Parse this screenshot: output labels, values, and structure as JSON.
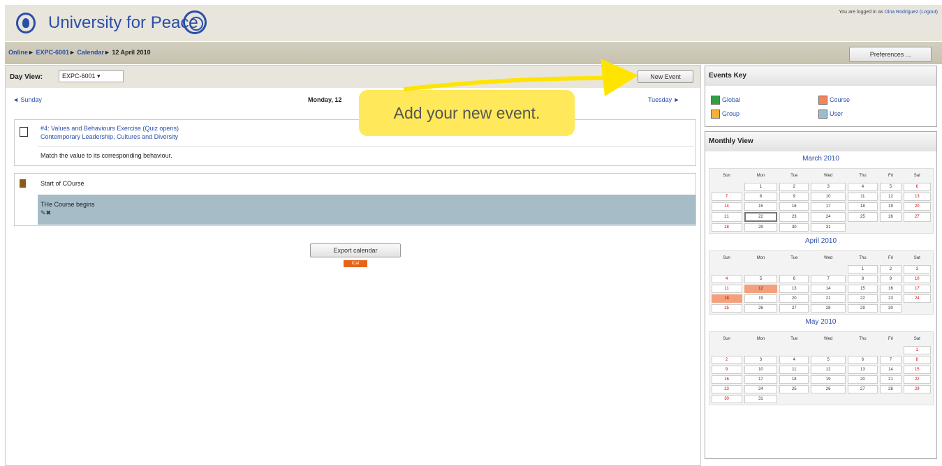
{
  "header": {
    "site_name": "University for Peace",
    "login_prefix": "You are logged in as",
    "user_name": "Dina Rodriguez",
    "logout_label": "(Logout)"
  },
  "breadcrumb": {
    "items": [
      "Online",
      "EXPC-6001",
      "Calendar"
    ],
    "current": "12 April 2010",
    "separator": "►"
  },
  "preferences_label": "Preferences ...",
  "day_view": {
    "label": "Day View:",
    "course_select": "EXPC-6001",
    "new_event_label": "New Event",
    "prev_label": "◄ Sunday",
    "date_heading": "Monday, 12",
    "next_label": "Tuesday ►"
  },
  "events": [
    {
      "title": "#4: Values and Behaviours Exercise (Quiz opens)",
      "course": "Contemporary Leadership, Cultures and Diversity",
      "description": "Match the value to its corresponding behaviour."
    },
    {
      "title": "Start of COurse",
      "description": "THe Course begins",
      "actions": "✎✖"
    }
  ],
  "export_label": "Export calendar",
  "ical_label": "iCal",
  "callout": "Add your new event.",
  "events_key": {
    "title": "Events Key",
    "items": [
      {
        "label": "Global",
        "color": "#2fa040"
      },
      {
        "label": "Course",
        "color": "#f4845a"
      },
      {
        "label": "Group",
        "color": "#f6b03a"
      },
      {
        "label": "User",
        "color": "#9bbcd0"
      }
    ]
  },
  "monthly": {
    "title": "Monthly View",
    "weekdays": [
      "Sun",
      "Mon",
      "Tue",
      "Wed",
      "Thu",
      "Fri",
      "Sat"
    ],
    "months": [
      {
        "name": "March 2010",
        "offset": 1,
        "days": 31,
        "highlight": [],
        "today": 22
      },
      {
        "name": "April 2010",
        "offset": 4,
        "days": 30,
        "highlight": [
          12,
          18
        ],
        "today": null
      },
      {
        "name": "May 2010",
        "offset": 6,
        "days": 31,
        "highlight": [],
        "today": null
      }
    ]
  }
}
